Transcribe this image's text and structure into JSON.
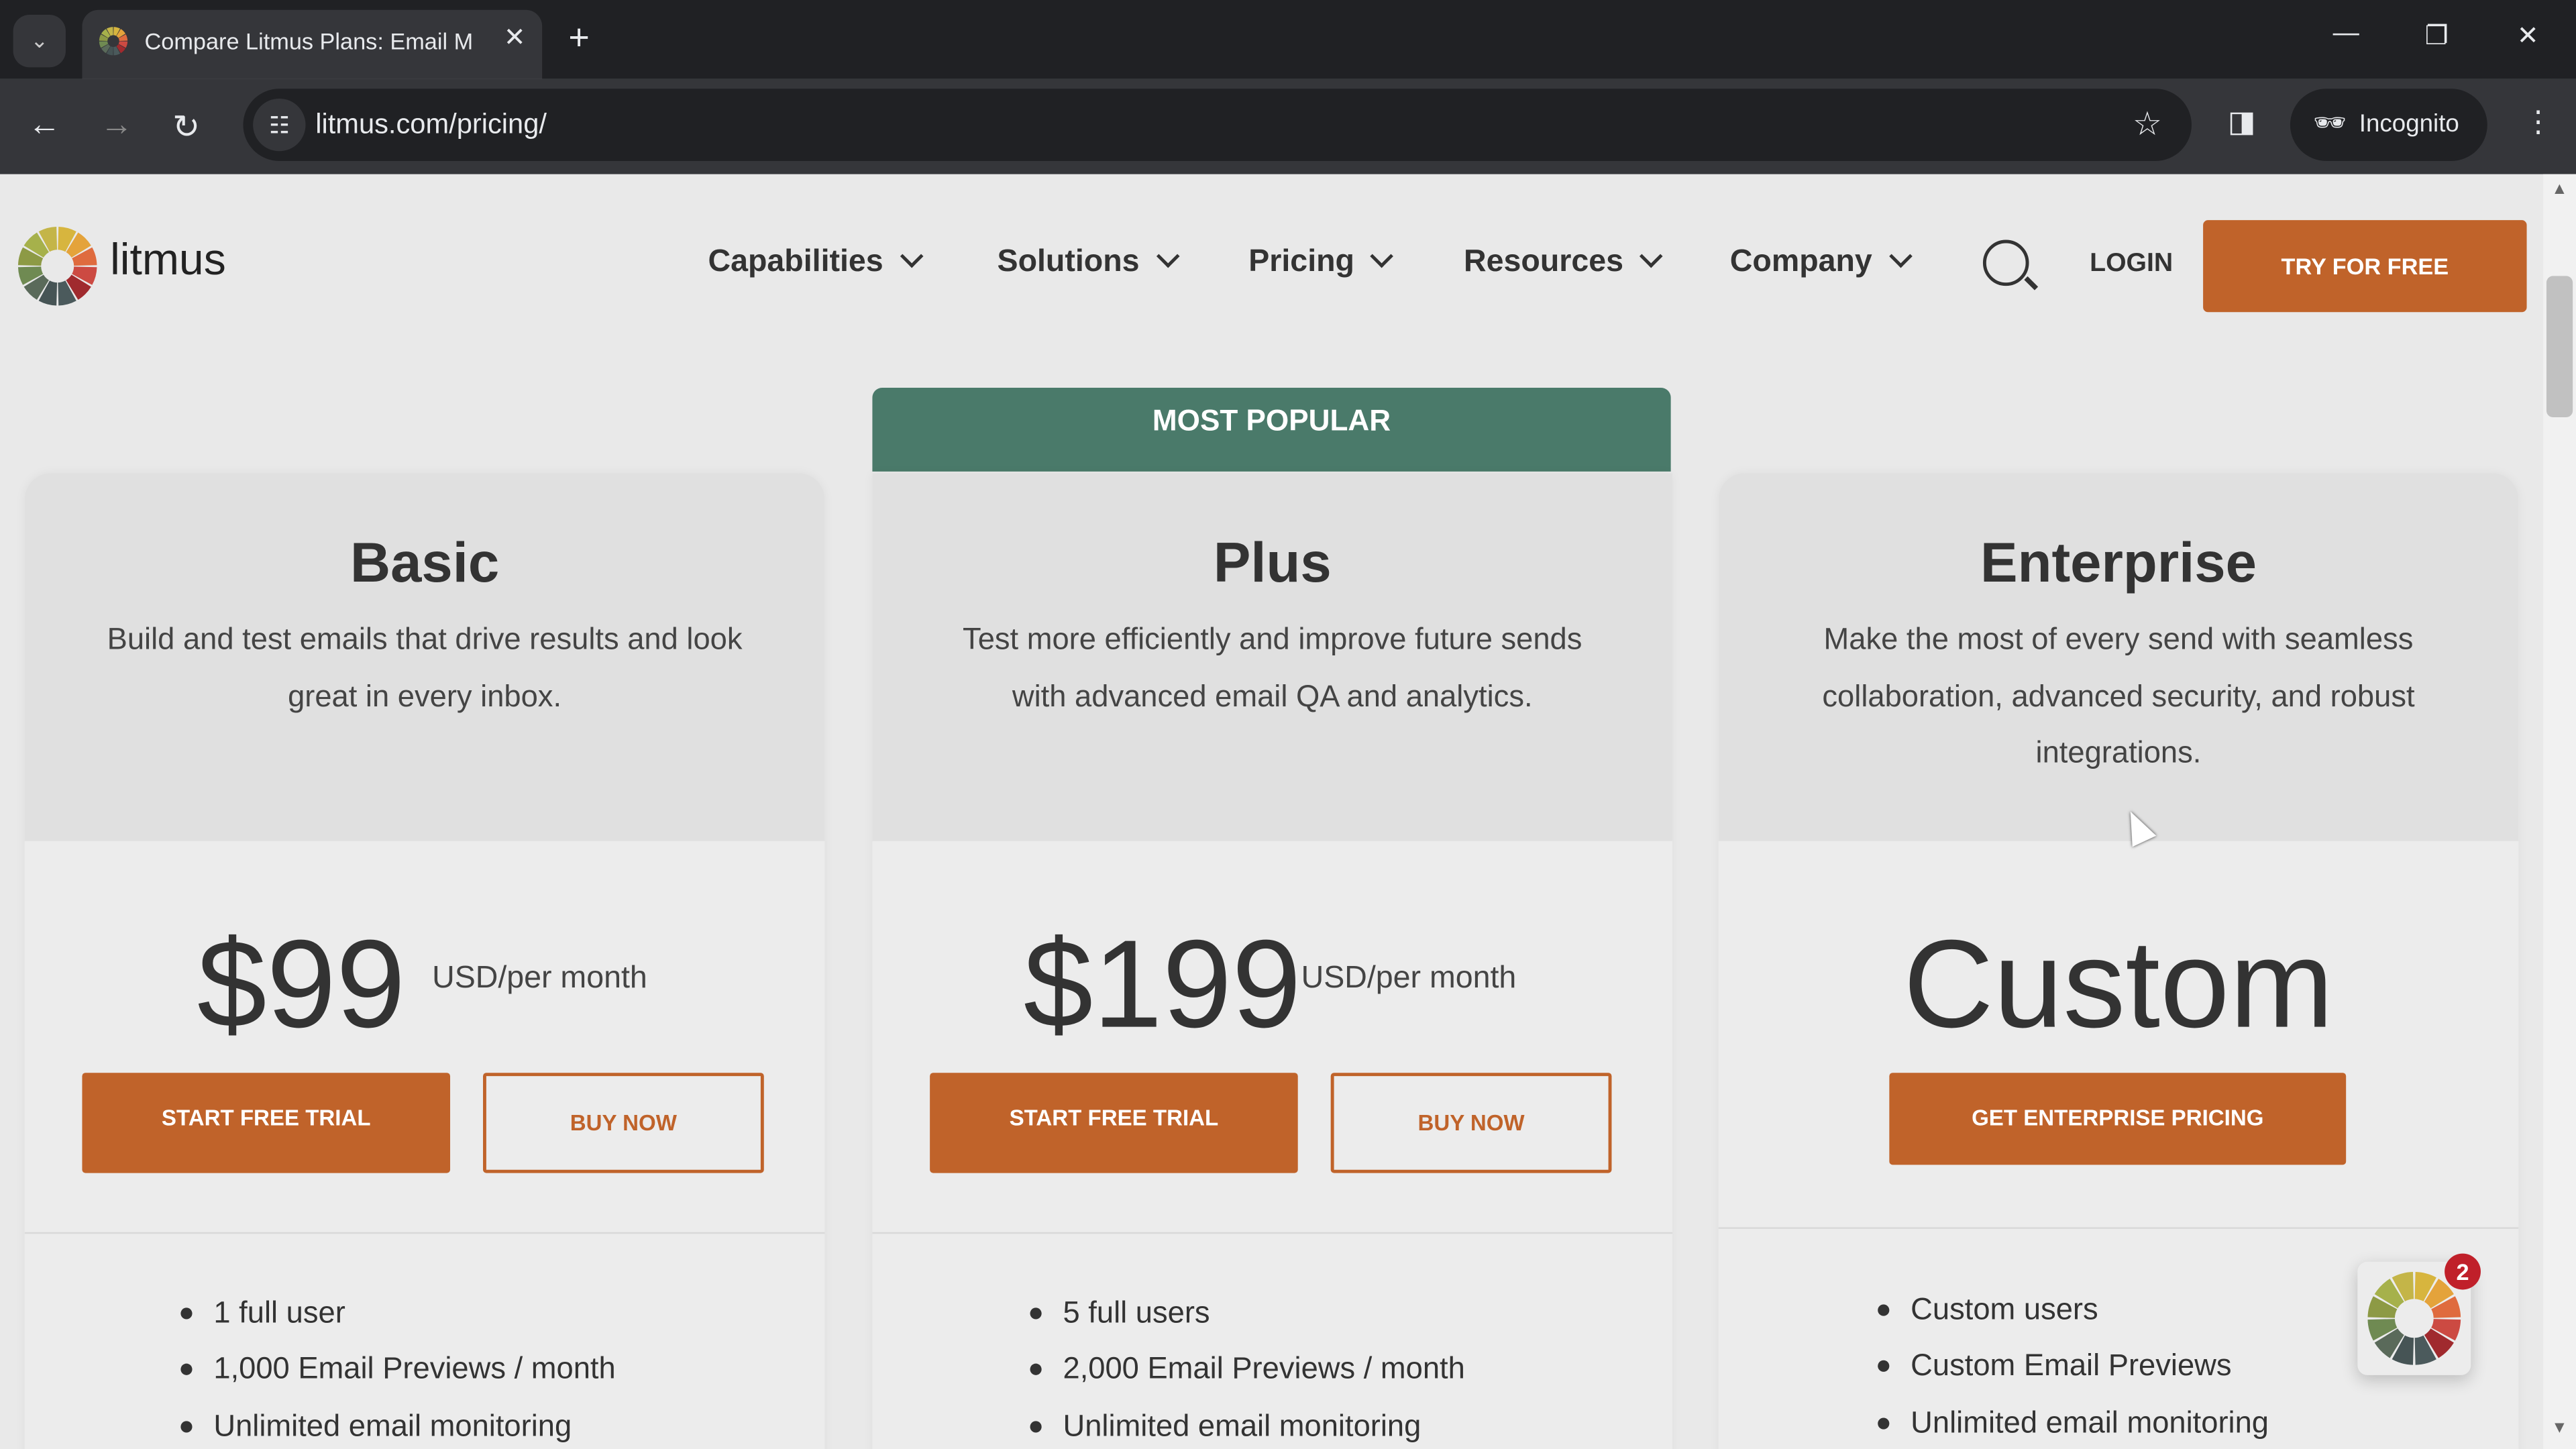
{
  "browser": {
    "tab_title": "Compare Litmus Plans: Email M",
    "url": "litmus.com/pricing/",
    "incognito_label": "Incognito"
  },
  "header": {
    "logo_text": "litmus",
    "menu": [
      "Capabilities",
      "Solutions",
      "Pricing",
      "Resources",
      "Company"
    ],
    "login": "LOGIN",
    "try_free": "TRY FOR FREE"
  },
  "most_popular": "MOST POPULAR",
  "plans": [
    {
      "name": "Basic",
      "description": "Build and test emails that drive results and look great in every inbox.",
      "price": "$99",
      "unit": "USD/per month",
      "primary": "START FREE TRIAL",
      "secondary": "BUY NOW",
      "features": [
        "1 full user",
        "1,000 Email Previews / month",
        "Unlimited email monitoring"
      ]
    },
    {
      "name": "Plus",
      "description": "Test more efficiently and improve future sends with advanced email QA and analytics.",
      "price": "$199",
      "unit": "USD/per month",
      "primary": "START FREE TRIAL",
      "secondary": "BUY NOW",
      "features": [
        "5 full users",
        "2,000 Email Previews / month",
        "Unlimited email monitoring"
      ]
    },
    {
      "name": "Enterprise",
      "description": "Make the most of every send with seamless collaboration, advanced security, and robust integrations.",
      "price": "Custom",
      "primary": "GET ENTERPRISE PRICING",
      "features": [
        "Custom users",
        "Custom Email Previews",
        "Unlimited email monitoring"
      ]
    }
  ],
  "chat_widget": {
    "badge": "2"
  },
  "colors": {
    "accent": "#c0632a",
    "banner": "#4a7a6a",
    "badge": "#c0202a"
  }
}
